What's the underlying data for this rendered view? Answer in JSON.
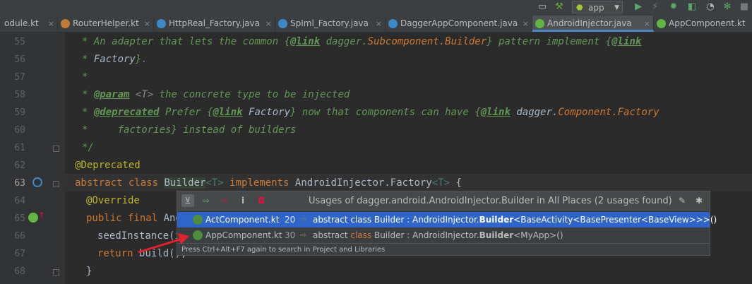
{
  "toolbar": {
    "run_config": "app",
    "icons": [
      "window-icon",
      "hammer-icon",
      "android-icon",
      "run-icon",
      "lightning-icon",
      "debug-icon",
      "coverage-icon",
      "profiler-icon",
      "attach-debugger-icon",
      "stop-icon"
    ]
  },
  "tabs": [
    {
      "label": "odule.kt",
      "close": "×"
    },
    {
      "label": "RouterHelper.kt",
      "close": "×"
    },
    {
      "label": "HttpReal_Factory.java",
      "close": "×"
    },
    {
      "label": "SpIml_Factory.java",
      "close": "×"
    },
    {
      "label": "DaggerAppComponent.java",
      "close": "×"
    },
    {
      "label": "AndroidInjector.java",
      "close": "×"
    },
    {
      "label": "AppComponent.kt",
      "close": ""
    }
  ],
  "code": {
    "lines": [
      {
        "n": "55"
      },
      {
        "n": "56"
      },
      {
        "n": "57"
      },
      {
        "n": "58"
      },
      {
        "n": "59"
      },
      {
        "n": "60"
      },
      {
        "n": "61"
      },
      {
        "n": "62"
      },
      {
        "n": "63"
      },
      {
        "n": "64"
      },
      {
        "n": "65"
      },
      {
        "n": "66"
      },
      {
        "n": "67"
      },
      {
        "n": "68"
      }
    ],
    "l55a": "* An adapter that lets the common {",
    "l55tag": "@link",
    "l55b": " dagger.",
    "l55c": "Subcomponent.Builder",
    "l55d": "} pattern implement {",
    "l55tag2": "@link",
    "l56a": "* ",
    "l56b": "Factory",
    "l56c": "}.",
    "l57": "*",
    "l58a": "* ",
    "l58tag": "@param",
    "l58b": " <T>",
    "l58c": " the concrete type to be injected",
    "l59a": "* ",
    "l59tag": "@deprecated",
    "l59b": " Prefer {",
    "l59tag2": "@link",
    "l59c": " Factory",
    "l59d": "} now that components can have {",
    "l59tag3": "@link",
    "l59e": " dagger.",
    "l59f": "Component.Factory",
    "l60a": "*     factories} instead of builders",
    "l61": "*/",
    "l62": "@Deprecated",
    "l63kw1": "abstract class ",
    "l63name": "Builder",
    "l63tp1": "<T>",
    "l63kw2": " implements ",
    "l63rest": "AndroidInjector.Factory",
    "l63tp2": "<T>",
    "l63end": " {",
    "l64": "@Override",
    "l65kw": "public final ",
    "l65rest": "And",
    "l66": "seedInstance(i",
    "l67kw": "return ",
    "l67rest": "build();",
    "l68": "}"
  },
  "usages": {
    "title": "Usages of dagger.android.AndroidInjector.Builder in All Places (2 usages found)",
    "rows": [
      {
        "file": "ActComponent.kt",
        "line": "20",
        "arrow": "⇨",
        "pre": "abstract class Builder : AndroidInjector.",
        "bold": "Builder",
        "post": "<BaseActivity<BasePresenter<BaseView>>>()"
      },
      {
        "file": "AppComponent.kt",
        "line": "30",
        "arrow": "⇨",
        "pre": "abstract ",
        "kw": "class",
        "mid": " Builder : AndroidInjector.",
        "bold": "Builder",
        "post": "<MyApp>()"
      }
    ],
    "footer": "Press Ctrl+Alt+F7 again to search in Project and Libraries",
    "buttons": [
      "merge-icon",
      "next-occurrence-icon",
      "prev-occurrence-icon",
      "info-icon",
      "stop-icon"
    ],
    "right_buttons": [
      "settings-icon",
      "pin-icon"
    ]
  }
}
